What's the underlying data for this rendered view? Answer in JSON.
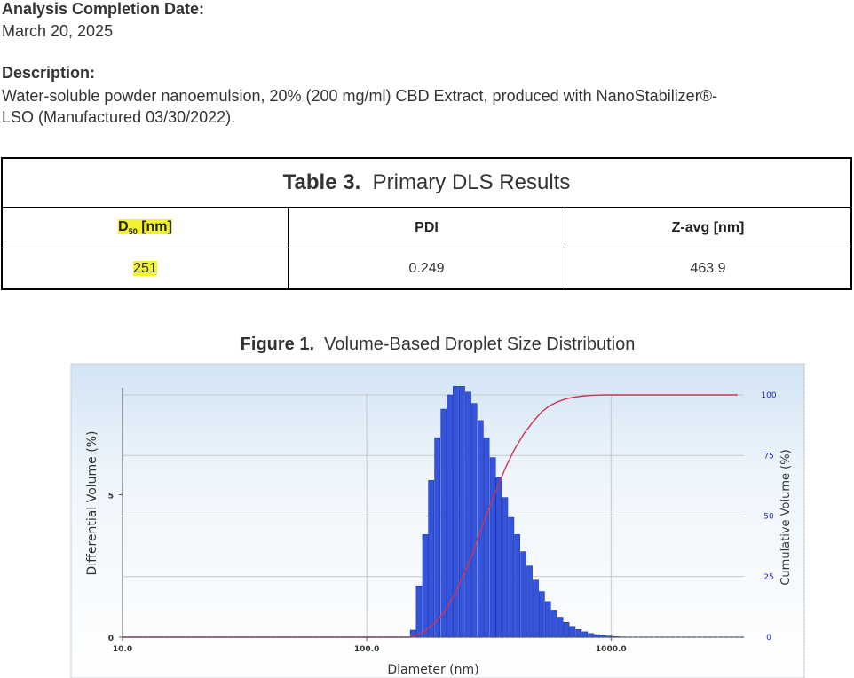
{
  "analysis": {
    "label": "Analysis Completion Date:",
    "value": "March 20, 2025"
  },
  "description": {
    "label": "Description:",
    "line1": "Water-soluble powder nanoemulsion, 20% (200 mg/ml) CBD Extract, produced with NanoStabilizer®-",
    "line2": "LSO (Manufactured 03/30/2022)."
  },
  "table": {
    "caption_bold": "Table 3.",
    "caption_rest": "Primary DLS Results",
    "headers": {
      "d50_main": "D",
      "d50_sub": "50",
      "d50_unit": "[nm]",
      "pdi": "PDI",
      "zavg": "Z-avg [nm]"
    },
    "values": {
      "d50": "251",
      "pdi": "0.249",
      "zavg": "463.9"
    },
    "highlight_color": "#f2f230"
  },
  "figure": {
    "caption_bold": "Figure 1.",
    "caption_rest": "Volume-Based Droplet Size Distribution"
  },
  "chart_data": {
    "type": "bar",
    "xlabel": "Diameter (nm)",
    "ylabel": "Differential Volume (%)",
    "y2label": "Cumulative Volume (%)",
    "x_scale": "log",
    "xlim": [
      10,
      3500
    ],
    "x_ticks": [
      "10.0",
      "100.0",
      "1000.0"
    ],
    "y_ticks": [
      "0",
      "5"
    ],
    "ylim": [
      0,
      8.5
    ],
    "y2_ticks": [
      "0",
      "25",
      "50",
      "75",
      "100"
    ],
    "y2lim": [
      0,
      100
    ],
    "grid": true,
    "colors": {
      "bars": "#3355dd",
      "cumulative": "#cc3355",
      "y2_ticks": "#2222cc",
      "background_top": "#d2e4f4",
      "background_bottom": "#ffffff"
    },
    "series": [
      {
        "type": "bar",
        "x": [
          155,
          164,
          174,
          184,
          195,
          207,
          219,
          232,
          246,
          261,
          276,
          293,
          310,
          329,
          348,
          369,
          391,
          414,
          439,
          465,
          493,
          522,
          553,
          586,
          621,
          658,
          697,
          739,
          783,
          830,
          879,
          931,
          987,
          1046,
          1108
        ],
        "values": [
          0.25,
          1.8,
          3.6,
          5.5,
          7.0,
          8.0,
          8.5,
          8.8,
          8.8,
          8.6,
          8.2,
          7.6,
          7.0,
          6.3,
          5.6,
          4.9,
          4.2,
          3.6,
          3.0,
          2.5,
          2.0,
          1.6,
          1.25,
          0.95,
          0.7,
          0.52,
          0.38,
          0.27,
          0.19,
          0.13,
          0.09,
          0.06,
          0.04,
          0.02,
          0.01
        ]
      },
      {
        "type": "line",
        "x": [
          10,
          150,
          170,
          190,
          210,
          230,
          250,
          270,
          290,
          310,
          340,
          370,
          400,
          440,
          480,
          520,
          560,
          600,
          650,
          700,
          760,
          820,
          880,
          950,
          1000,
          3300
        ],
        "values": [
          0,
          0,
          2,
          6,
          11,
          18,
          26,
          34,
          43,
          51,
          61,
          70,
          77,
          84,
          89,
          93,
          95.5,
          97,
          98.3,
          99,
          99.5,
          99.8,
          99.9,
          100,
          100,
          100
        ]
      }
    ]
  }
}
